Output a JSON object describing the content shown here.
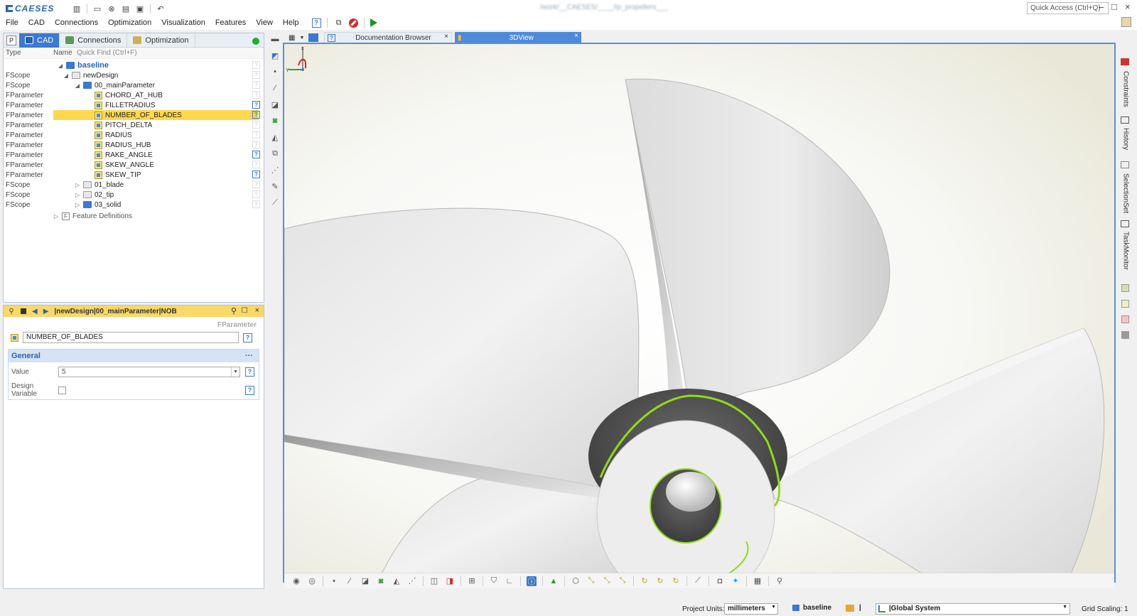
{
  "app": {
    "logo": "CAESES",
    "window_title": "/work/__CAESES/____/ip_propellers___",
    "quick_access_placeholder": "Quick Access (Ctrl+Q)",
    "min": "–",
    "max": "□",
    "close": "×"
  },
  "menu": [
    "File",
    "CAD",
    "Connections",
    "Optimization",
    "Visualization",
    "Features",
    "View",
    "Help"
  ],
  "left_tabs": {
    "p": "P",
    "cad": "CAD",
    "connections": "Connections",
    "optimization": "Optimization"
  },
  "tree": {
    "header_type": "Type",
    "header_name": "Name",
    "quick_find": "Quick Find (Ctrl+F)",
    "root": "baseline",
    "rows": [
      {
        "type": "FScope",
        "name": "newDesign",
        "indent": 1,
        "kind": "folder-grey",
        "expander": "◢",
        "help": false
      },
      {
        "type": "FScope",
        "name": "00_mainParameter",
        "indent": 2,
        "kind": "folder-blue",
        "expander": "◢",
        "help": false
      },
      {
        "type": "FParameter",
        "name": "CHORD_AT_HUB",
        "indent": 3,
        "kind": "param",
        "expander": "",
        "help": false
      },
      {
        "type": "FParameter",
        "name": "FILLETRADIUS",
        "indent": 3,
        "kind": "param",
        "expander": "",
        "help": true
      },
      {
        "type": "FParameter",
        "name": "NUMBER_OF_BLADES",
        "indent": 3,
        "kind": "param",
        "expander": "",
        "help": true,
        "selected": true
      },
      {
        "type": "FParameter",
        "name": "PITCH_DELTA",
        "indent": 3,
        "kind": "param",
        "expander": "",
        "help": false
      },
      {
        "type": "FParameter",
        "name": "RADIUS",
        "indent": 3,
        "kind": "param",
        "expander": "",
        "help": false
      },
      {
        "type": "FParameter",
        "name": "RADIUS_HUB",
        "indent": 3,
        "kind": "param",
        "expander": "",
        "help": false
      },
      {
        "type": "FParameter",
        "name": "RAKE_ANGLE",
        "indent": 3,
        "kind": "param",
        "expander": "",
        "help": true
      },
      {
        "type": "FParameter",
        "name": "SKEW_ANGLE",
        "indent": 3,
        "kind": "param",
        "expander": "",
        "help": false
      },
      {
        "type": "FParameter",
        "name": "SKEW_TIP",
        "indent": 3,
        "kind": "param",
        "expander": "",
        "help": true
      },
      {
        "type": "FScope",
        "name": "01_blade",
        "indent": 2,
        "kind": "folder-grey",
        "expander": "▷",
        "help": false
      },
      {
        "type": "FScope",
        "name": "02_tip",
        "indent": 2,
        "kind": "folder-grey",
        "expander": "▷",
        "help": false
      },
      {
        "type": "FScope",
        "name": "03_solid",
        "indent": 2,
        "kind": "folder-blue",
        "expander": "▷",
        "help": false
      }
    ],
    "feature_definitions": "Feature Definitions"
  },
  "props": {
    "path": "|newDesign|00_mainParameter|NOB",
    "type": "FParameter",
    "name_value": "NUMBER_OF_BLADES",
    "section": "General",
    "section_more": "···",
    "value_label": "Value",
    "value": "5",
    "design_variable_label": "Design Variable"
  },
  "doc_tabs": {
    "doc_browser": "Documentation Browser",
    "view3d": "3DView"
  },
  "right_sidebar": [
    "Constraints",
    "History",
    "SelectionSet",
    "TaskMonitor"
  ],
  "status": {
    "project_units_label": "Project Units:",
    "units": "millimeters",
    "baseline": "baseline",
    "pipe": "|",
    "coordinate_system": "|Global System",
    "grid_scaling": "Grid Scaling: 1"
  },
  "colors": {
    "accent": "#3a7ad1",
    "selection": "#ffd84d",
    "prop_header": "#f8d867",
    "viewport_border": "#5a8fd6",
    "edge_highlight": "#8edc16"
  }
}
